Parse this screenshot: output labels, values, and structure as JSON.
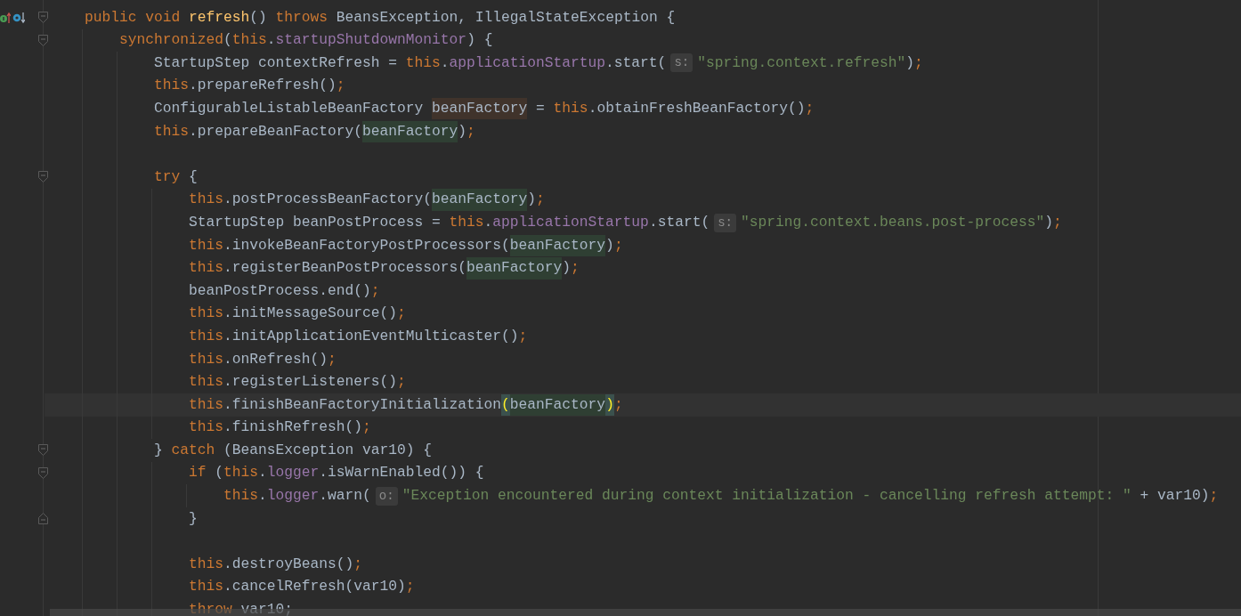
{
  "editor": {
    "lines": [
      {
        "current": false,
        "fold": {
          "kind": "start"
        },
        "gutter_icons": [
          {
            "kind": "implements"
          },
          {
            "kind": "overridden"
          }
        ],
        "tokens": [
          {
            "text": "public void ",
            "kind": "keyword"
          },
          {
            "text": "refresh",
            "kind": "method"
          },
          {
            "text": "() ",
            "kind": "plain"
          },
          {
            "text": "throws ",
            "kind": "keyword"
          },
          {
            "text": "BeansException, IllegalStateException {",
            "kind": "plain"
          }
        ],
        "children": [
          {
            "current": false,
            "fold": {
              "kind": "start"
            },
            "tokens": [
              {
                "text": "synchronized",
                "kind": "keyword"
              },
              {
                "text": "(",
                "kind": "plain"
              },
              {
                "text": "this",
                "kind": "keyword"
              },
              {
                "text": ".",
                "kind": "plain"
              },
              {
                "text": "startupShutdownMonitor",
                "kind": "field"
              },
              {
                "text": ") {",
                "kind": "plain"
              }
            ],
            "children": [
              {
                "current": false,
                "tokens": [
                  {
                    "text": "StartupStep contextRefresh = ",
                    "kind": "plain"
                  },
                  {
                    "text": "this",
                    "kind": "keyword"
                  },
                  {
                    "text": ".",
                    "kind": "plain"
                  },
                  {
                    "text": "applicationStartup",
                    "kind": "field"
                  },
                  {
                    "text": ".start(",
                    "kind": "plain"
                  },
                  {
                    "text": "s:",
                    "kind": "hint"
                  },
                  {
                    "text": "\"spring.context.refresh\"",
                    "kind": "string"
                  },
                  {
                    "text": ")",
                    "kind": "plain"
                  },
                  {
                    "text": ";",
                    "kind": "keyword"
                  }
                ]
              },
              {
                "current": false,
                "tokens": [
                  {
                    "text": "this",
                    "kind": "keyword"
                  },
                  {
                    "text": ".prepareRefresh()",
                    "kind": "plain"
                  },
                  {
                    "text": ";",
                    "kind": "keyword"
                  }
                ]
              },
              {
                "current": false,
                "tokens": [
                  {
                    "text": "ConfigurableListableBeanFactory ",
                    "kind": "plain"
                  },
                  {
                    "text": "beanFactory",
                    "kind": "write-usage"
                  },
                  {
                    "text": " = ",
                    "kind": "plain"
                  },
                  {
                    "text": "this",
                    "kind": "keyword"
                  },
                  {
                    "text": ".obtainFreshBeanFactory()",
                    "kind": "plain"
                  },
                  {
                    "text": ";",
                    "kind": "keyword"
                  }
                ]
              },
              {
                "current": false,
                "tokens": [
                  {
                    "text": "this",
                    "kind": "keyword"
                  },
                  {
                    "text": ".prepareBeanFactory(",
                    "kind": "plain"
                  },
                  {
                    "text": "beanFactory",
                    "kind": "read-usage"
                  },
                  {
                    "text": ")",
                    "kind": "plain"
                  },
                  {
                    "text": ";",
                    "kind": "keyword"
                  }
                ]
              },
              {
                "current": false
              },
              {
                "current": false,
                "fold": {
                  "kind": "start"
                },
                "tokens": [
                  {
                    "text": "try ",
                    "kind": "keyword"
                  },
                  {
                    "text": "{",
                    "kind": "plain"
                  }
                ],
                "children": [
                  {
                    "current": false,
                    "tokens": [
                      {
                        "text": "this",
                        "kind": "keyword"
                      },
                      {
                        "text": ".postProcessBeanFactory(",
                        "kind": "plain"
                      },
                      {
                        "text": "beanFactory",
                        "kind": "read-usage"
                      },
                      {
                        "text": ")",
                        "kind": "plain"
                      },
                      {
                        "text": ";",
                        "kind": "keyword"
                      }
                    ]
                  },
                  {
                    "current": false,
                    "tokens": [
                      {
                        "text": "StartupStep beanPostProcess = ",
                        "kind": "plain"
                      },
                      {
                        "text": "this",
                        "kind": "keyword"
                      },
                      {
                        "text": ".",
                        "kind": "plain"
                      },
                      {
                        "text": "applicationStartup",
                        "kind": "field"
                      },
                      {
                        "text": ".start(",
                        "kind": "plain"
                      },
                      {
                        "text": "s:",
                        "kind": "hint"
                      },
                      {
                        "text": "\"spring.context.beans.post-process\"",
                        "kind": "string"
                      },
                      {
                        "text": ")",
                        "kind": "plain"
                      },
                      {
                        "text": ";",
                        "kind": "keyword"
                      }
                    ]
                  },
                  {
                    "current": false,
                    "tokens": [
                      {
                        "text": "this",
                        "kind": "keyword"
                      },
                      {
                        "text": ".invokeBeanFactoryPostProcessors(",
                        "kind": "plain"
                      },
                      {
                        "text": "beanFactory",
                        "kind": "read-usage"
                      },
                      {
                        "text": ")",
                        "kind": "plain"
                      },
                      {
                        "text": ";",
                        "kind": "keyword"
                      }
                    ]
                  },
                  {
                    "current": false,
                    "tokens": [
                      {
                        "text": "this",
                        "kind": "keyword"
                      },
                      {
                        "text": ".registerBeanPostProcessors(",
                        "kind": "plain"
                      },
                      {
                        "text": "beanFactory",
                        "kind": "read-usage"
                      },
                      {
                        "text": ")",
                        "kind": "plain"
                      },
                      {
                        "text": ";",
                        "kind": "keyword"
                      }
                    ]
                  },
                  {
                    "current": false,
                    "tokens": [
                      {
                        "text": "beanPostProcess.end()",
                        "kind": "plain"
                      },
                      {
                        "text": ";",
                        "kind": "keyword"
                      }
                    ]
                  },
                  {
                    "current": false,
                    "tokens": [
                      {
                        "text": "this",
                        "kind": "keyword"
                      },
                      {
                        "text": ".initMessageSource()",
                        "kind": "plain"
                      },
                      {
                        "text": ";",
                        "kind": "keyword"
                      }
                    ]
                  },
                  {
                    "current": false,
                    "tokens": [
                      {
                        "text": "this",
                        "kind": "keyword"
                      },
                      {
                        "text": ".initApplicationEventMulticaster()",
                        "kind": "plain"
                      },
                      {
                        "text": ";",
                        "kind": "keyword"
                      }
                    ]
                  },
                  {
                    "current": false,
                    "tokens": [
                      {
                        "text": "this",
                        "kind": "keyword"
                      },
                      {
                        "text": ".onRefresh()",
                        "kind": "plain"
                      },
                      {
                        "text": ";",
                        "kind": "keyword"
                      }
                    ]
                  },
                  {
                    "current": false,
                    "tokens": [
                      {
                        "text": "this",
                        "kind": "keyword"
                      },
                      {
                        "text": ".registerListeners()",
                        "kind": "plain"
                      },
                      {
                        "text": ";",
                        "kind": "keyword"
                      }
                    ]
                  },
                  {
                    "current": true,
                    "tokens": [
                      {
                        "text": "this",
                        "kind": "keyword"
                      },
                      {
                        "text": ".finishBeanFactoryInitialization",
                        "kind": "plain"
                      },
                      {
                        "text": "(",
                        "kind": "brace-match"
                      },
                      {
                        "text": "beanFactory",
                        "kind": "read-usage"
                      },
                      {
                        "text": ")",
                        "kind": "brace-match"
                      },
                      {
                        "text": ";",
                        "kind": "keyword"
                      }
                    ]
                  },
                  {
                    "current": false,
                    "tokens": [
                      {
                        "text": "this",
                        "kind": "keyword"
                      },
                      {
                        "text": ".finishRefresh()",
                        "kind": "plain"
                      },
                      {
                        "text": ";",
                        "kind": "keyword"
                      }
                    ]
                  }
                ]
              },
              {
                "current": false,
                "fold": {
                  "kind": "start"
                },
                "tokens": [
                  {
                    "text": "} ",
                    "kind": "plain"
                  },
                  {
                    "text": "catch ",
                    "kind": "keyword"
                  },
                  {
                    "text": "(BeansException var10) {",
                    "kind": "plain"
                  }
                ],
                "children": [
                  {
                    "current": false,
                    "fold": {
                      "kind": "start"
                    },
                    "tokens": [
                      {
                        "text": "if ",
                        "kind": "keyword"
                      },
                      {
                        "text": "(",
                        "kind": "plain"
                      },
                      {
                        "text": "this",
                        "kind": "keyword"
                      },
                      {
                        "text": ".",
                        "kind": "plain"
                      },
                      {
                        "text": "logger",
                        "kind": "field"
                      },
                      {
                        "text": ".isWarnEnabled()) {",
                        "kind": "plain"
                      }
                    ],
                    "children": [
                      {
                        "current": false,
                        "tokens": [
                          {
                            "text": "this",
                            "kind": "keyword"
                          },
                          {
                            "text": ".",
                            "kind": "plain"
                          },
                          {
                            "text": "logger",
                            "kind": "field"
                          },
                          {
                            "text": ".warn(",
                            "kind": "plain"
                          },
                          {
                            "text": "o:",
                            "kind": "hint"
                          },
                          {
                            "text": "\"Exception encountered during context initialization - cancelling refresh attempt: \"",
                            "kind": "string"
                          },
                          {
                            "text": " + var10)",
                            "kind": "plain"
                          },
                          {
                            "text": ";",
                            "kind": "keyword"
                          }
                        ]
                      }
                    ]
                  },
                  {
                    "current": false,
                    "fold": {
                      "kind": "end"
                    },
                    "tokens": [
                      {
                        "text": "}",
                        "kind": "plain"
                      }
                    ]
                  },
                  {
                    "current": false
                  },
                  {
                    "current": false,
                    "tokens": [
                      {
                        "text": "this",
                        "kind": "keyword"
                      },
                      {
                        "text": ".destroyBeans()",
                        "kind": "plain"
                      },
                      {
                        "text": ";",
                        "kind": "keyword"
                      }
                    ]
                  },
                  {
                    "current": false,
                    "tokens": [
                      {
                        "text": "this",
                        "kind": "keyword"
                      },
                      {
                        "text": ".cancelRefresh(var10)",
                        "kind": "plain"
                      },
                      {
                        "text": ";",
                        "kind": "keyword"
                      }
                    ]
                  },
                  {
                    "current": false,
                    "tokens": [
                      {
                        "text": "throw ",
                        "kind": "keyword"
                      },
                      {
                        "text": "var10;",
                        "kind": "plain"
                      }
                    ]
                  }
                ]
              }
            ]
          }
        ]
      }
    ]
  }
}
